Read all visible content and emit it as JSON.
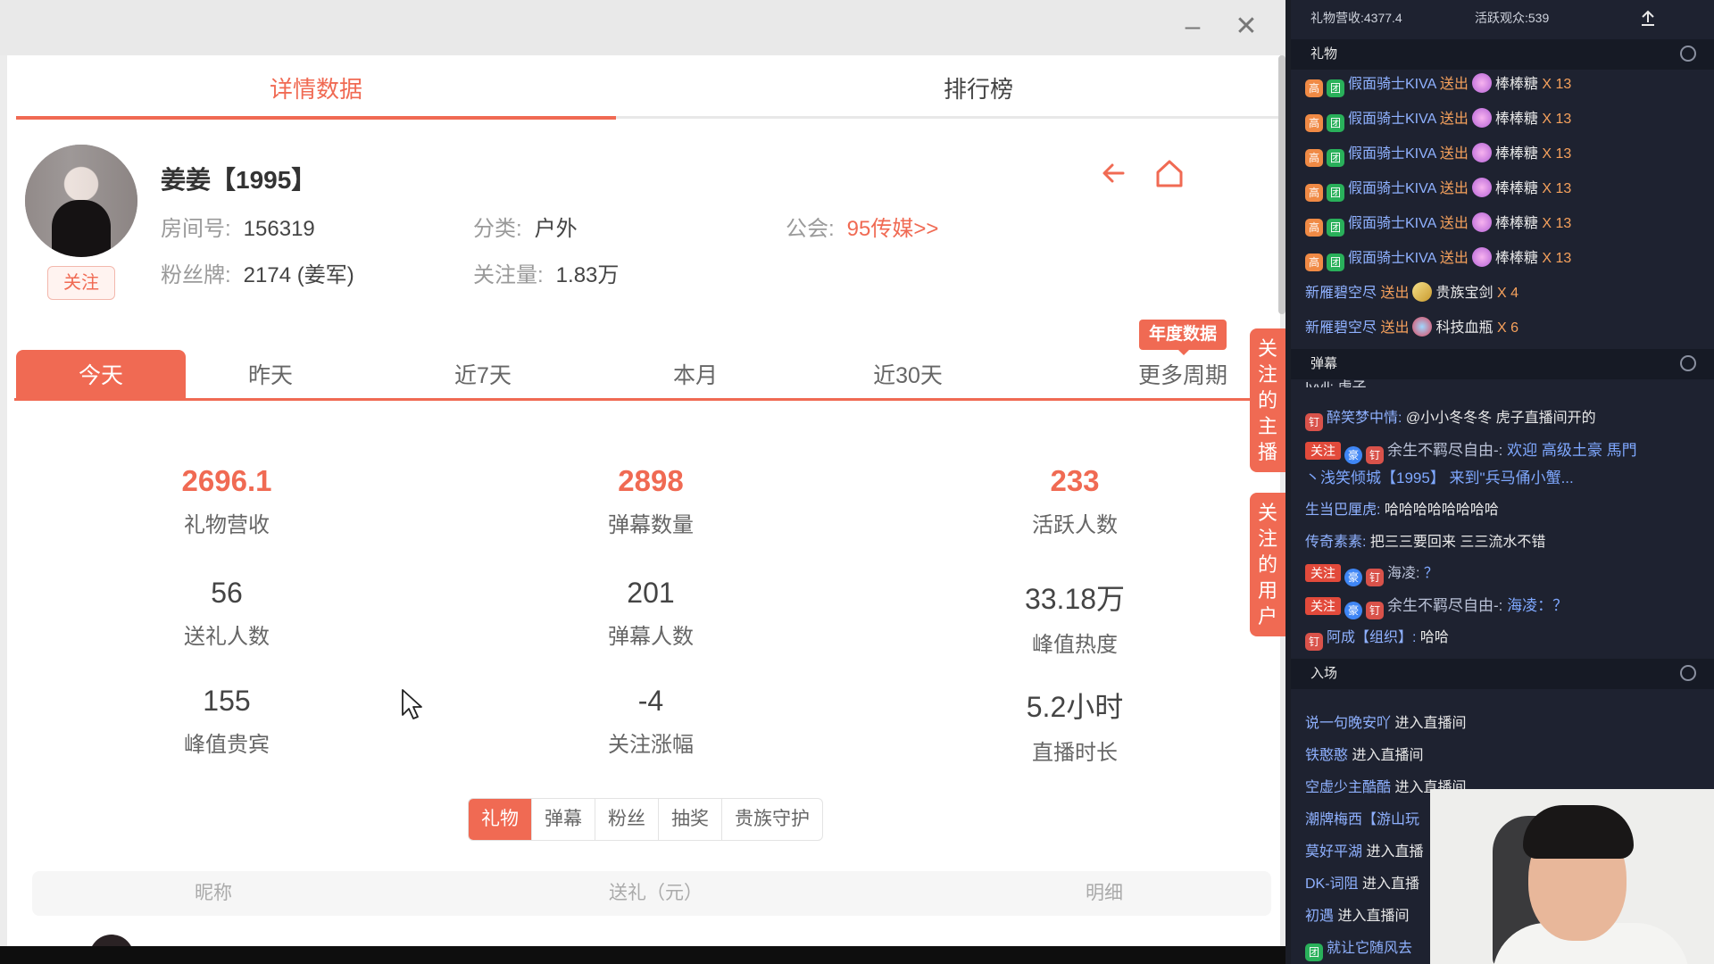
{
  "window": {
    "minimize_icon": "minimize-icon",
    "close_icon": "close-icon"
  },
  "main_tabs": [
    {
      "label": "详情数据",
      "active": true
    },
    {
      "label": "排行榜",
      "active": false
    }
  ],
  "streamer": {
    "name": "姜姜【1995】",
    "follow_button": "关注",
    "room_label": "房间号:",
    "room_value": "156319",
    "category_label": "分类:",
    "category_value": "户外",
    "guild_label": "公会:",
    "guild_value": "95传媒>>",
    "fanbadge_label": "粉丝牌:",
    "fanbadge_value": "2174 (姜军)",
    "followers_label": "关注量:",
    "followers_value": "1.83万"
  },
  "range_tabs": [
    "今天",
    "昨天",
    "近7天",
    "本月",
    "近30天",
    "更多周期"
  ],
  "annual_badge": "年度数据",
  "stats": [
    {
      "value": "2696.1",
      "label": "礼物营收",
      "highlight": true
    },
    {
      "value": "2898",
      "label": "弹幕数量",
      "highlight": true
    },
    {
      "value": "233",
      "label": "活跃人数",
      "highlight": true
    },
    {
      "value": "56",
      "label": "送礼人数",
      "highlight": false
    },
    {
      "value": "201",
      "label": "弹幕人数",
      "highlight": false
    },
    {
      "value": "33.18万",
      "label": "峰值热度",
      "highlight": false
    },
    {
      "value": "155",
      "label": "峰值贵宾",
      "highlight": false
    },
    {
      "value": "-4",
      "label": "关注涨幅",
      "highlight": false
    },
    {
      "value": "5.2小时",
      "label": "直播时长",
      "highlight": false
    }
  ],
  "sub_tabs": [
    "礼物",
    "弹幕",
    "粉丝",
    "抽奖",
    "贵族守护"
  ],
  "table_headers": [
    "昵称",
    "送礼（元）",
    "明细"
  ],
  "side_pills": [
    "关注的主播",
    "关注的用户"
  ],
  "live_panel": {
    "gift_revenue_label": "礼物营收:",
    "gift_revenue": "4377.4",
    "active_label": "活跃观众:",
    "active_value": "539",
    "sections": {
      "gift": "礼物",
      "danmu": "弹幕",
      "enter": "入场"
    },
    "gifts": [
      {
        "user": "假面骑士KIVA",
        "action": "送出",
        "item": "棒棒糖",
        "count": "X 13"
      },
      {
        "user": "假面骑士KIVA",
        "action": "送出",
        "item": "棒棒糖",
        "count": "X 13"
      },
      {
        "user": "假面骑士KIVA",
        "action": "送出",
        "item": "棒棒糖",
        "count": "X 13"
      },
      {
        "user": "假面骑士KIVA",
        "action": "送出",
        "item": "棒棒糖",
        "count": "X 13"
      },
      {
        "user": "假面骑士KIVA",
        "action": "送出",
        "item": "棒棒糖",
        "count": "X 13"
      },
      {
        "user": "假面骑士KIVA",
        "action": "送出",
        "item": "棒棒糖",
        "count": "X 13"
      },
      {
        "user": "新雁碧空尽",
        "action": "送出",
        "item": "贵族宝剑",
        "count": "X 4"
      },
      {
        "user": "新雁碧空尽",
        "action": "送出",
        "item": "科技血瓶",
        "count": "X 6"
      }
    ],
    "danmu_partial": "Iyyll: 虎子",
    "danmu": [
      {
        "user": "醉笑梦中情:",
        "text": "@小小冬冬冬 虎子直播间开的"
      },
      {
        "follow_tag": "关注",
        "user": "余生不羁尽自由-:",
        "text": "欢迎 高级土豪 馬門"
      },
      {
        "text": "丶浅笑倾城【1995】 来到\"兵马俑小蟹..."
      },
      {
        "user": "生当巴厘虎:",
        "text": "哈哈哈哈哈哈哈哈"
      },
      {
        "user": "传奇素素:",
        "text": "把三三要回来 三三流水不错"
      },
      {
        "follow_tag": "关注",
        "user": "海凌:",
        "text": "？"
      },
      {
        "follow_tag": "关注",
        "user": "余生不羁尽自由-:",
        "text": "海凌：？"
      },
      {
        "user": "阿成【组织】:",
        "text": "哈哈"
      }
    ],
    "enters": [
      {
        "user": "说一句晚安吖",
        "action": "进入直播间"
      },
      {
        "user": "铁憨憨",
        "action": "进入直播间"
      },
      {
        "user": "空虚少主酷酷",
        "action": "进入直播间"
      },
      {
        "user": "潮牌梅西【游山玩",
        "action": ""
      },
      {
        "user": "莫好平湖",
        "action": "进入直播"
      },
      {
        "user": "DK-词阻",
        "action": "进入直播"
      },
      {
        "user": "初遇",
        "action": "进入直播间"
      },
      {
        "user": "就让它随风去",
        "action": ""
      }
    ]
  }
}
